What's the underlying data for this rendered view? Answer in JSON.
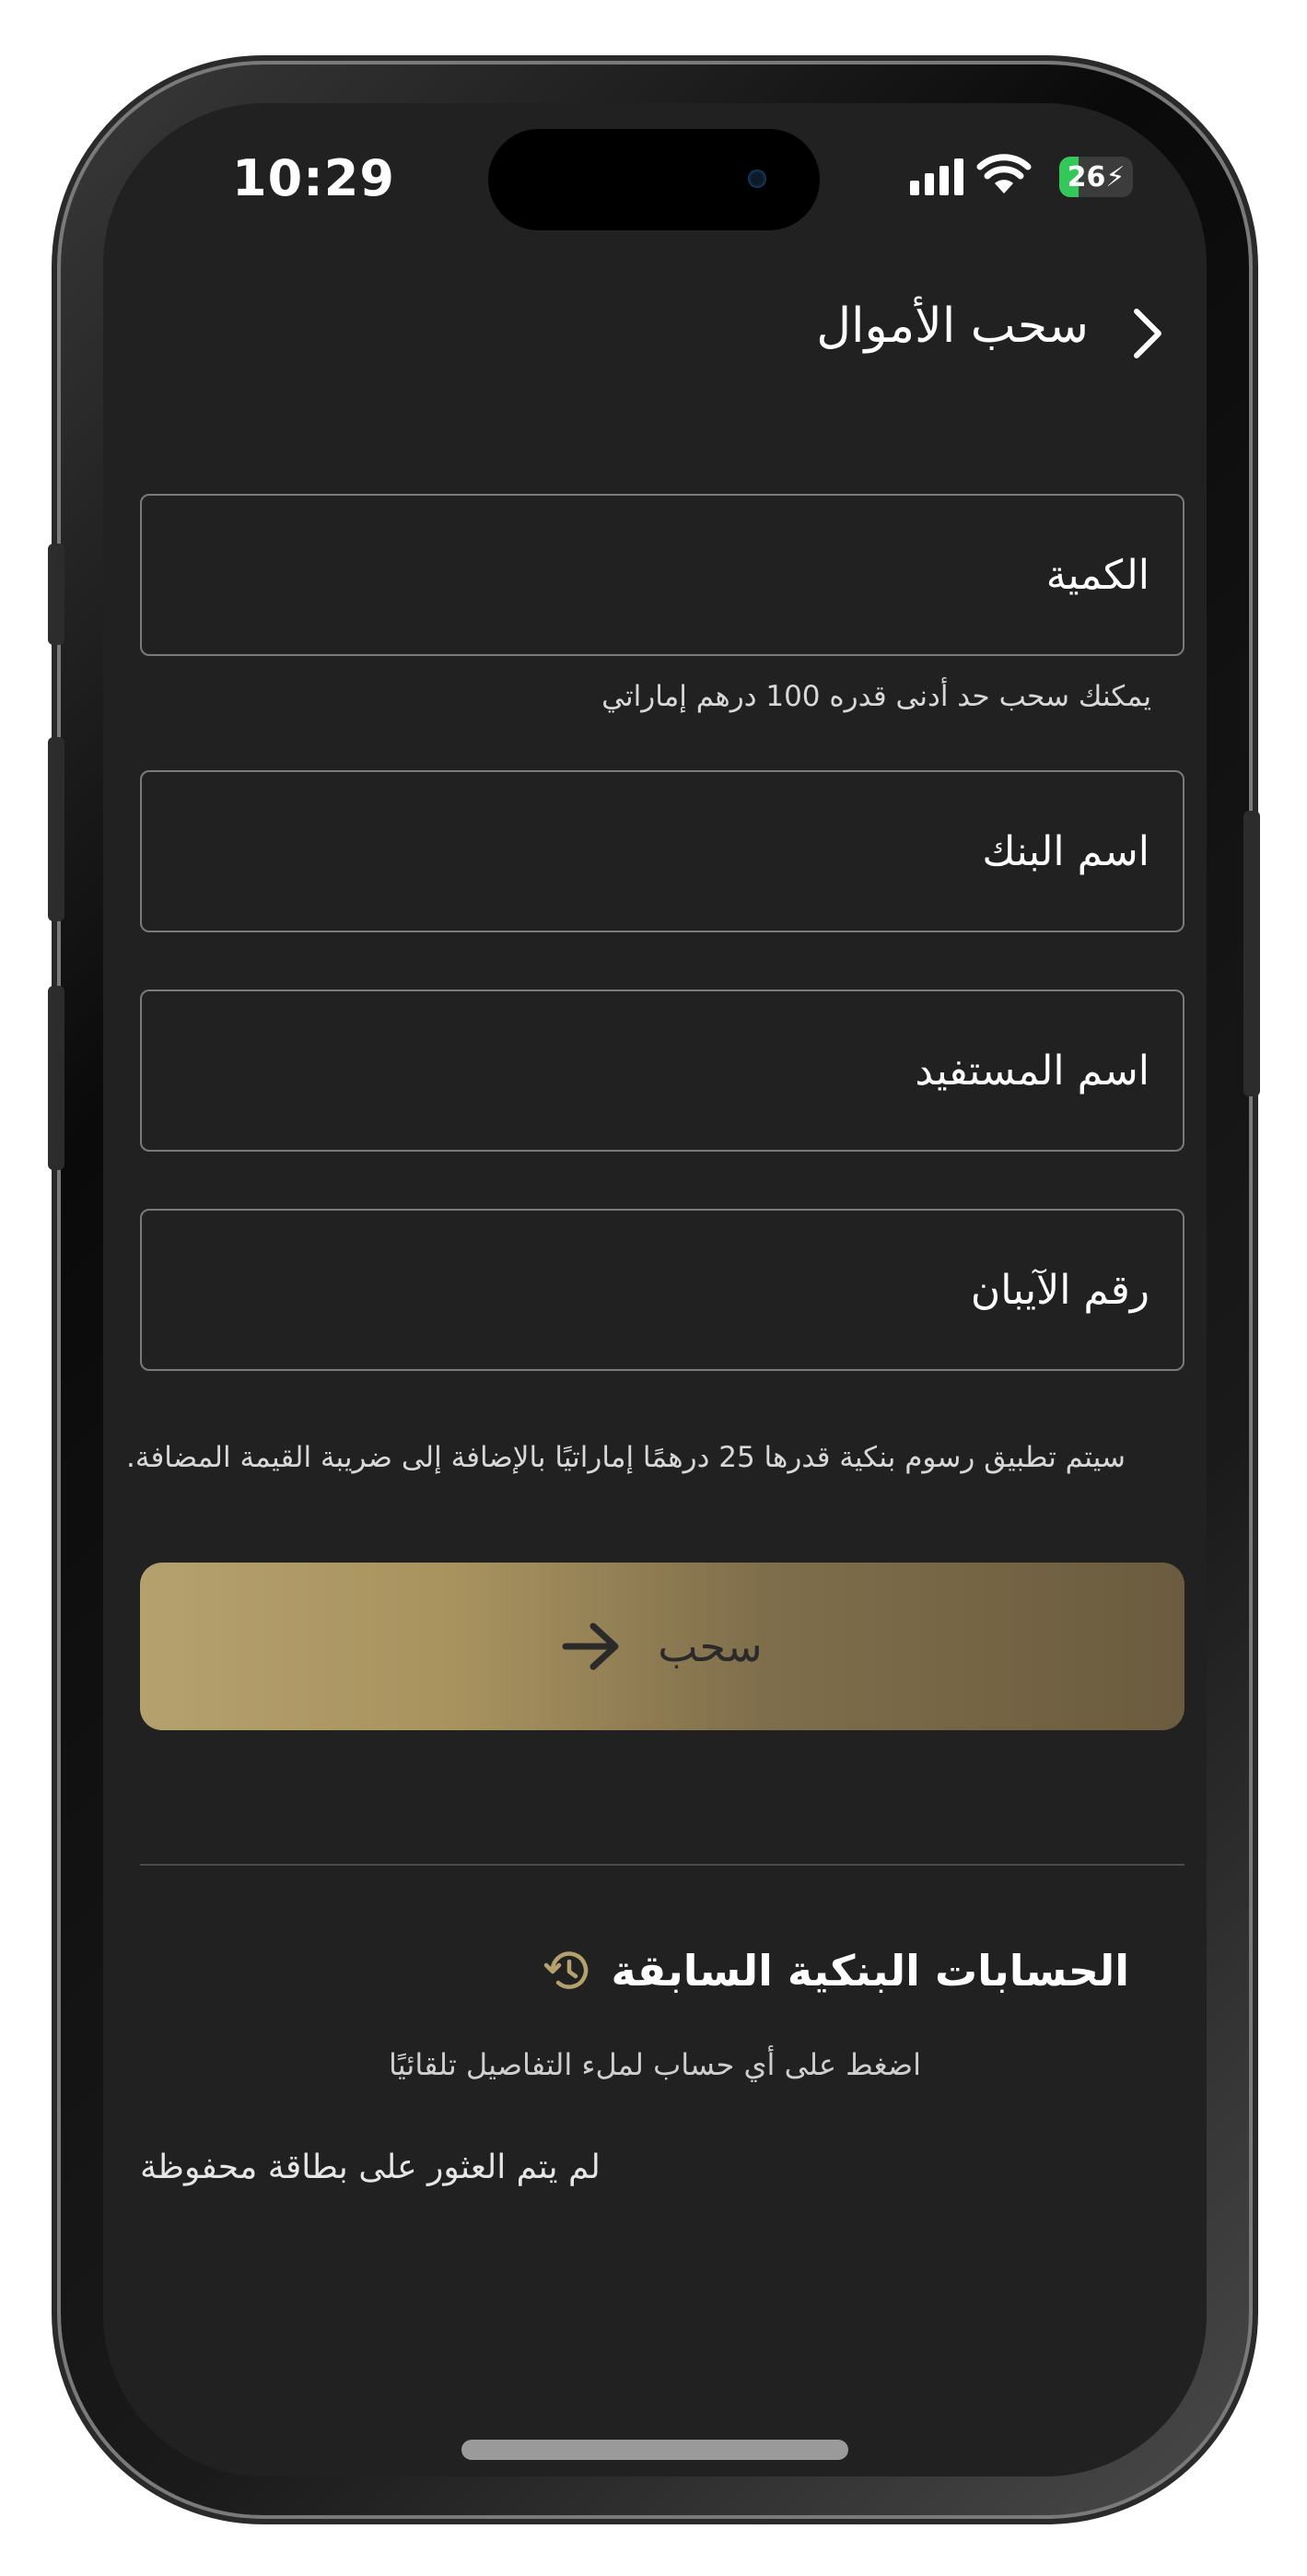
{
  "status_bar": {
    "time": "10:29",
    "battery_level": "26",
    "battery_fraction": 0.26
  },
  "header": {
    "title": "سحب الأموال",
    "back_icon": "chevron-right-icon"
  },
  "form": {
    "amount_placeholder": "الكمية",
    "amount_value": "",
    "amount_hint": "يمكنك سحب حد أدنى قدره 100 درهم إماراتي",
    "bank_name_placeholder": "اسم البنك",
    "bank_name_value": "",
    "beneficiary_placeholder": "اسم المستفيد",
    "beneficiary_value": "",
    "iban_placeholder": "رقم الآيبان",
    "iban_value": "",
    "fee_note": "سيتم تطبيق رسوم بنكية قدرها 25 درهمًا إماراتيًا بالإضافة إلى ضريبة القيمة المضافة."
  },
  "submit": {
    "label": "سحب",
    "icon": "arrow-right-icon"
  },
  "saved_accounts": {
    "title": "الحسابات البنكية السابقة",
    "icon": "history-icon",
    "subtitle": "اضغط على أي حساب لملء التفاصيل تلقائيًا",
    "empty_message": "لم يتم العثور على بطاقة محفوظة"
  },
  "colors": {
    "background": "#212121",
    "accent_gold": "#b5a16e",
    "text": "#ffffff",
    "field_border": "#7a7a7a",
    "battery_green": "#34c759"
  }
}
